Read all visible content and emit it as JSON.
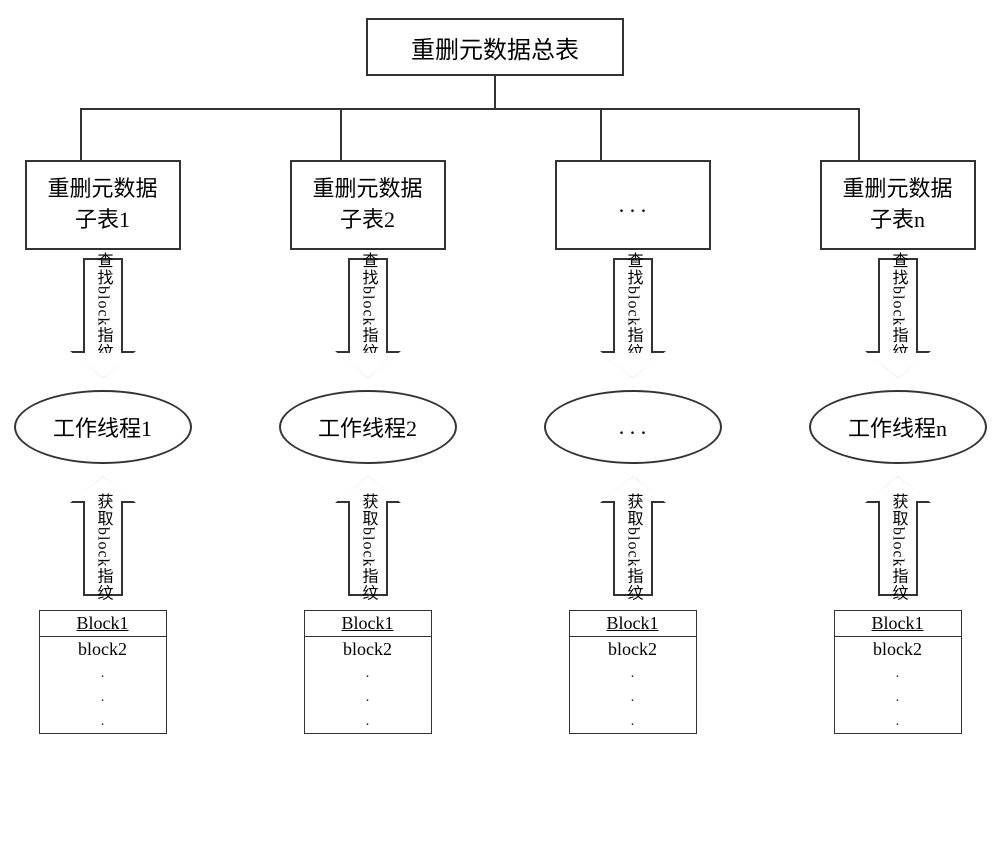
{
  "top_title": "重删元数据总表",
  "columns": [
    {
      "sub": "重删元数据\n子表1",
      "arrow_down": "查找block指纹",
      "ellipse": "工作线程1",
      "arrow_up": "获取block指纹",
      "blocks": [
        "Block1",
        "block2",
        ".",
        ".",
        "."
      ]
    },
    {
      "sub": "重删元数据\n子表2",
      "arrow_down": "查找block指纹",
      "ellipse": "工作线程2",
      "arrow_up": "获取block指纹",
      "blocks": [
        "Block1",
        "block2",
        ".",
        ".",
        "."
      ]
    },
    {
      "sub": ". . .",
      "arrow_down": "查找block指纹",
      "ellipse": ". . .",
      "arrow_up": "获取block指纹",
      "blocks": [
        "Block1",
        "block2",
        ".",
        ".",
        "."
      ]
    },
    {
      "sub": "重删元数据\n子表n",
      "arrow_down": "查找block指纹",
      "ellipse": "工作线程n",
      "arrow_up": "获取block指纹",
      "blocks": [
        "Block1",
        "block2",
        ".",
        ".",
        "."
      ]
    }
  ]
}
